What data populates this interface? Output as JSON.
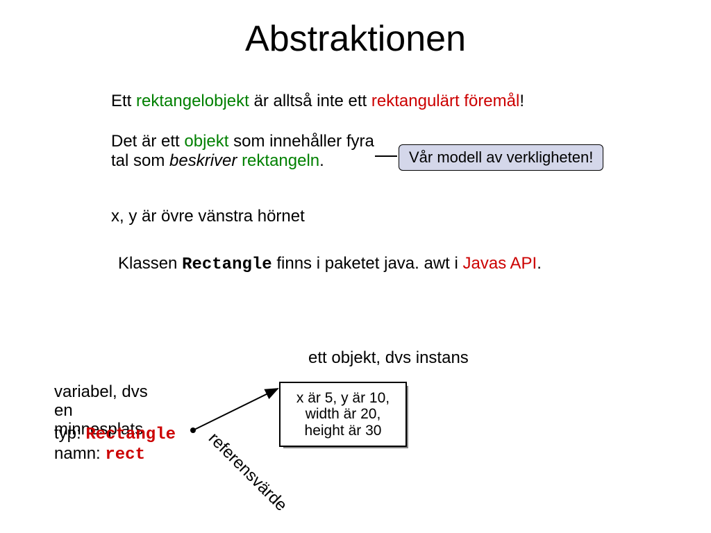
{
  "title": "Abstraktionen",
  "line1": {
    "t1": "Ett ",
    "t2": "rektangelobjekt",
    "t3": " är alltså inte ett ",
    "t4": "rektangulärt föremål",
    "t5": "!"
  },
  "para2": {
    "t1": "Det är ett ",
    "t2": "objekt",
    "t3": " som innehåller fyra tal som ",
    "t4": "beskriver",
    "t5": "rektangeln",
    "t6": "."
  },
  "line3": "x, y är övre vänstra hörnet",
  "para4": {
    "t1": "Klassen ",
    "t2": "Rectangle",
    "t3": " finns i paketet java. awt i ",
    "t4": "Javas API",
    "t5": "."
  },
  "modelBox": "Vår modell av verkligheten!",
  "instansLabel": "ett objekt, dvs instans",
  "varBlock": {
    "l1": "variabel, dvs",
    "l2": "en",
    "l3a": "minnesplats",
    "l3b": "typ: ",
    "l3c": "Rectangle",
    "l4a": "namn: ",
    "l4b": "rect"
  },
  "objBox": {
    "l1": "x är 5, y är 10,",
    "l2": "width är 20,",
    "l3": "height är 30"
  },
  "refLabel": "referensvärde"
}
